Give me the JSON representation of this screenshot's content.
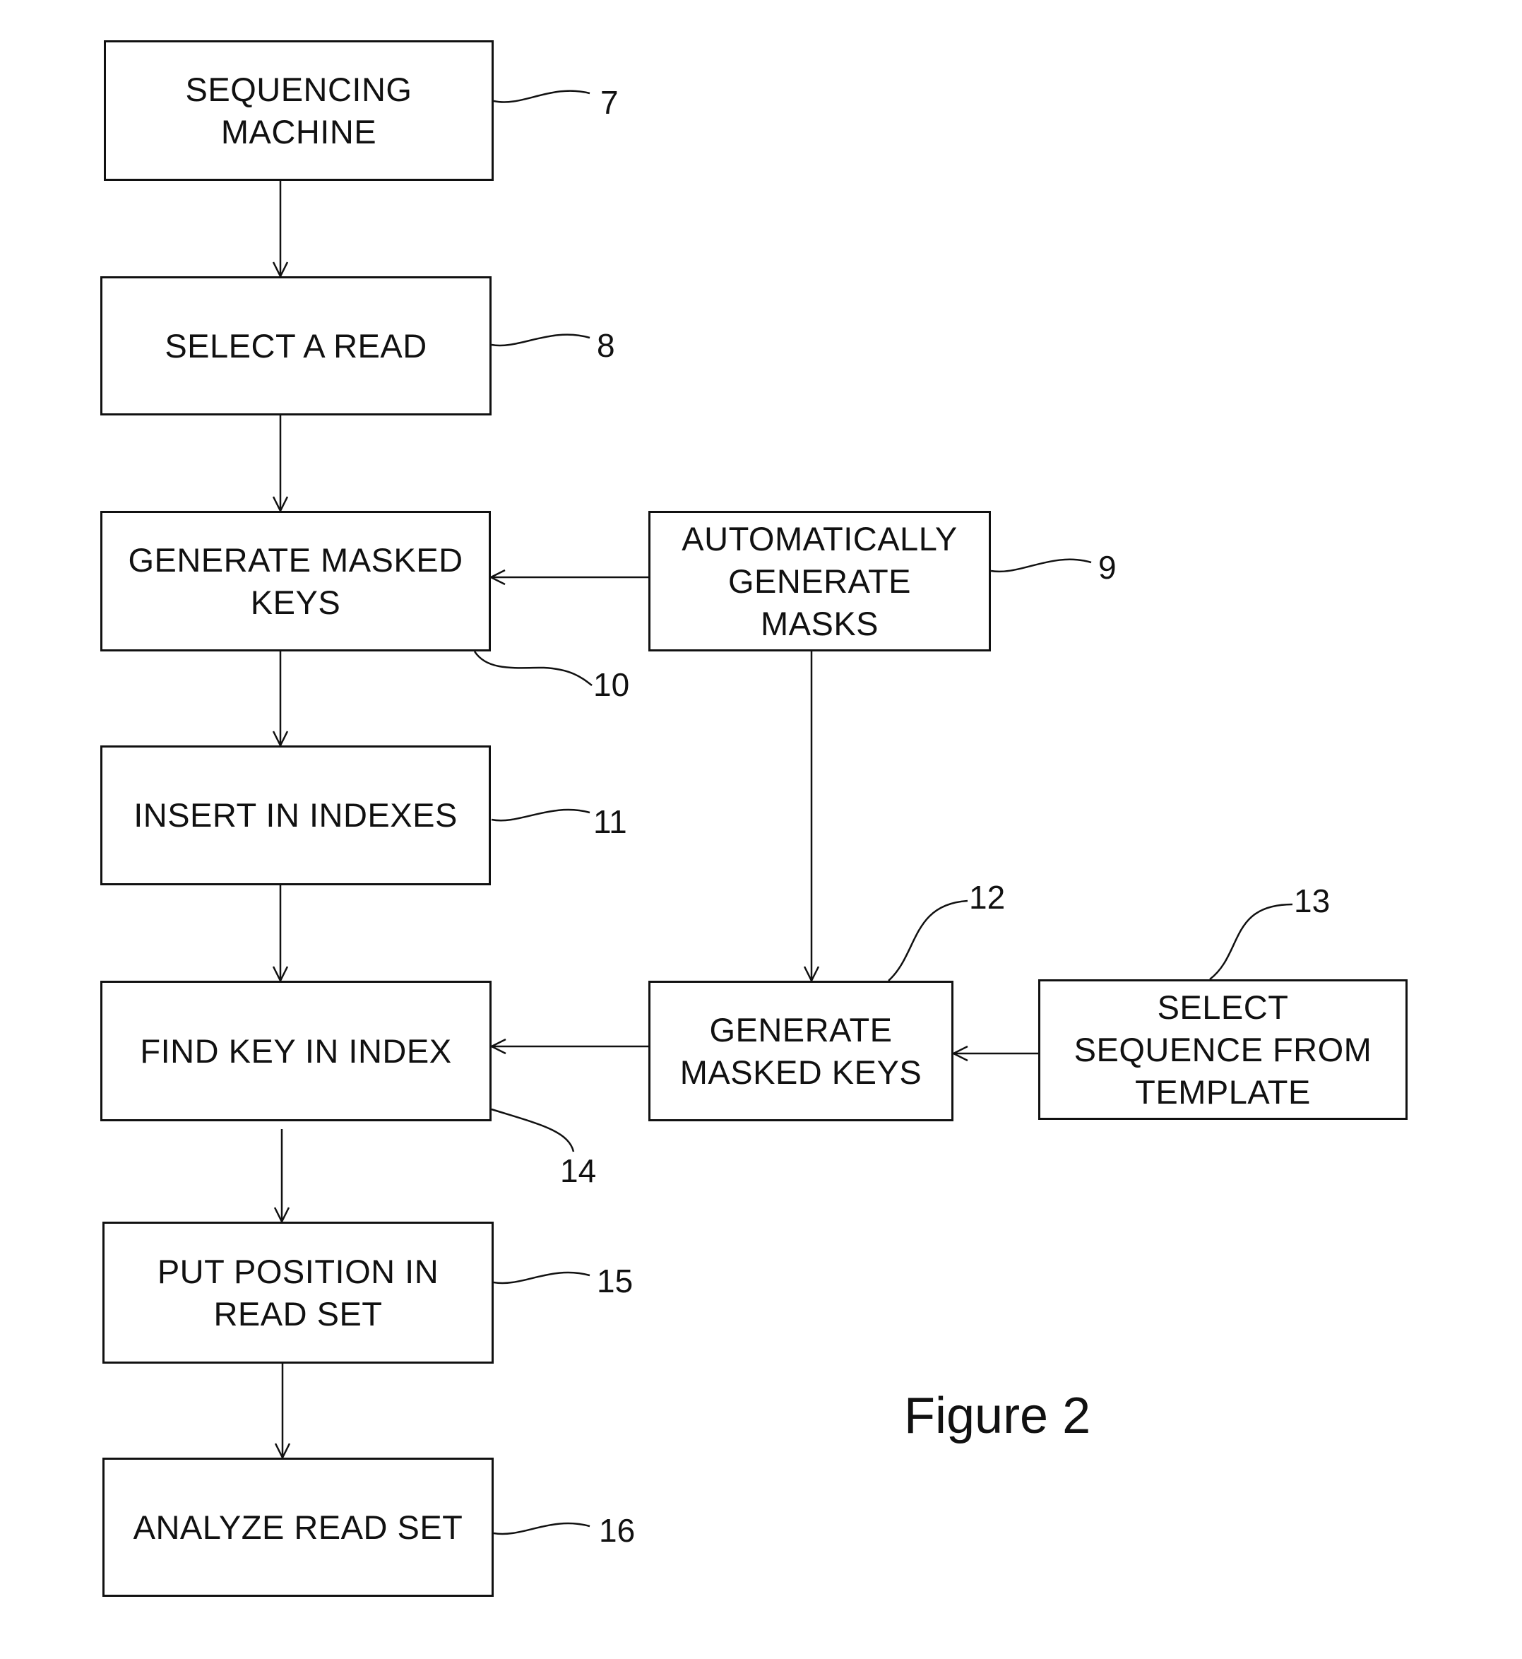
{
  "figure": {
    "caption": "Figure 2",
    "nodes": [
      {
        "id": "7",
        "label": "SEQUENCING\nMACHINE"
      },
      {
        "id": "8",
        "label": "SELECT A READ"
      },
      {
        "id": "10",
        "label": "GENERATE MASKED\nKEYS"
      },
      {
        "id": "9",
        "label": "AUTOMATICALLY\nGENERATE\nMASKS"
      },
      {
        "id": "11",
        "label": "INSERT IN INDEXES"
      },
      {
        "id": "14",
        "label": "FIND KEY IN INDEX"
      },
      {
        "id": "12",
        "label": "GENERATE\nMASKED KEYS"
      },
      {
        "id": "13",
        "label": "SELECT\nSEQUENCE FROM\nTEMPLATE"
      },
      {
        "id": "15",
        "label": "PUT POSITION IN\nREAD SET"
      },
      {
        "id": "16",
        "label": "ANALYZE READ SET"
      }
    ],
    "reference_numerals": [
      "7",
      "8",
      "9",
      "10",
      "11",
      "12",
      "13",
      "14",
      "15",
      "16"
    ],
    "edges": [
      {
        "from": "7",
        "to": "8"
      },
      {
        "from": "8",
        "to": "10"
      },
      {
        "from": "9",
        "to": "10"
      },
      {
        "from": "10",
        "to": "11"
      },
      {
        "from": "9",
        "to": "12"
      },
      {
        "from": "11",
        "to": "14"
      },
      {
        "from": "12",
        "to": "14"
      },
      {
        "from": "13",
        "to": "12"
      },
      {
        "from": "14",
        "to": "15"
      },
      {
        "from": "15",
        "to": "16"
      }
    ],
    "colors": {
      "ink": "#111111",
      "background": "#ffffff"
    }
  }
}
